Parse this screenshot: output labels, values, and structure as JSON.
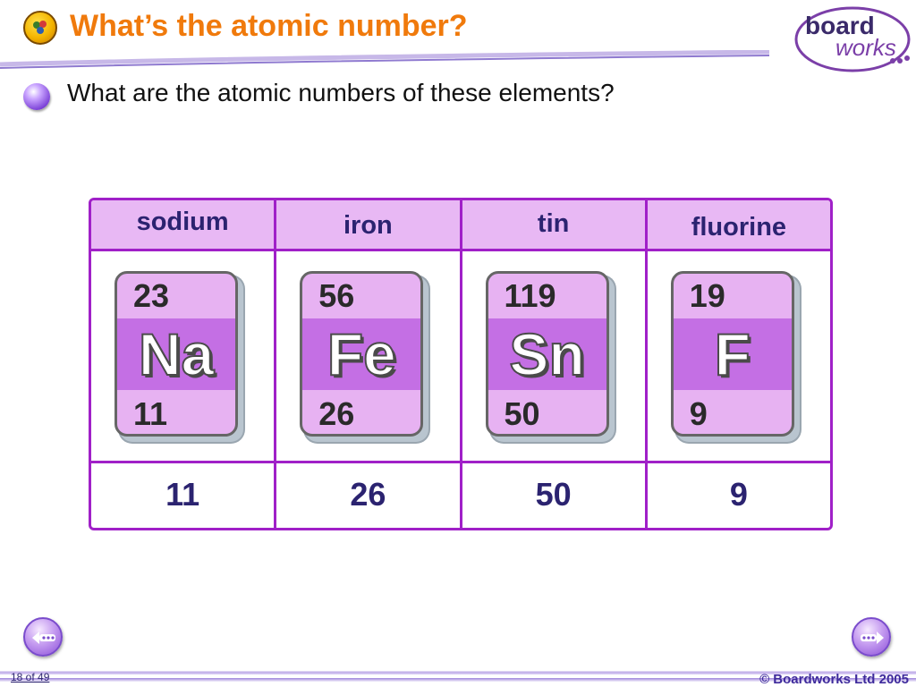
{
  "header": {
    "title": "What’s the atomic number?",
    "logo_text_1": "board",
    "logo_text_2": "works"
  },
  "question": "What are the atomic numbers of these elements?",
  "table": {
    "elements": [
      {
        "name": "sodium",
        "mass": "23",
        "symbol": "Na",
        "atomic_number": "11",
        "answer": "11"
      },
      {
        "name": "iron",
        "mass": "56",
        "symbol": "Fe",
        "atomic_number": "26",
        "answer": "26"
      },
      {
        "name": "tin",
        "mass": "119",
        "symbol": "Sn",
        "atomic_number": "50",
        "answer": "50"
      },
      {
        "name": "fluorine",
        "mass": "19",
        "symbol": "F",
        "atomic_number": "9",
        "answer": "9"
      }
    ]
  },
  "footer": {
    "page_counter": "18 of 49",
    "copyright": "© Boardworks Ltd 2005",
    "prev_icon": "prev-arrow-icon",
    "next_icon": "next-arrow-icon"
  },
  "colors": {
    "title": "#f07a0c",
    "table_border": "#a020c8",
    "header_fill": "#e8b8f4",
    "answer_text": "#2b2370"
  }
}
